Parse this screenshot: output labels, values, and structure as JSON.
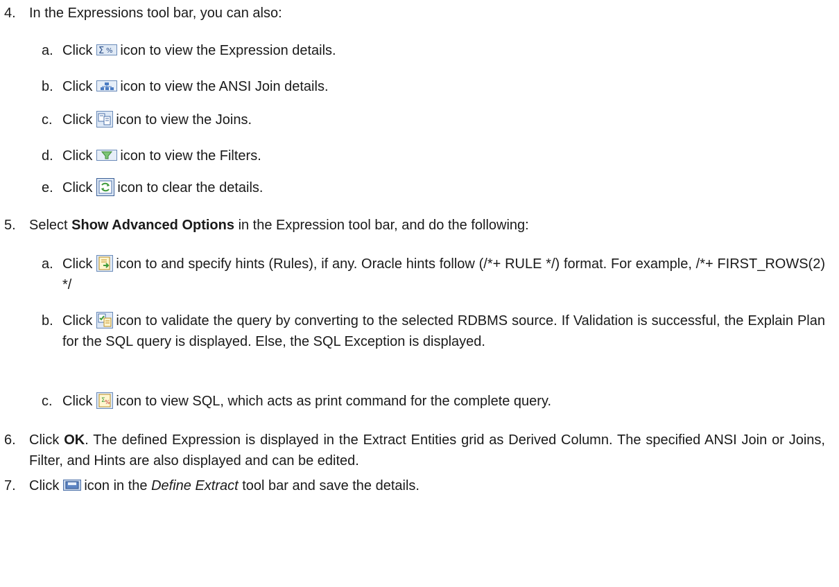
{
  "steps": {
    "s4": {
      "num": "4.",
      "text": "In the Expressions tool bar, you can also:"
    },
    "s4a": {
      "letter": "a.",
      "pre": "Click",
      "post": "icon to view the Expression details.",
      "icon": "expression-icon"
    },
    "s4b": {
      "letter": "b.",
      "pre": "Click",
      "post": "icon to view the ANSI Join details.",
      "icon": "ansi-join-icon"
    },
    "s4c": {
      "letter": "c.",
      "pre": "Click",
      "post": "icon to view the Joins.",
      "icon": "joins-icon"
    },
    "s4d": {
      "letter": "d.",
      "pre": "Click",
      "post": "icon to view the Filters.",
      "icon": "filter-icon"
    },
    "s4e": {
      "letter": "e.",
      "pre": "Click",
      "post": "icon to clear the details.",
      "icon": "clear-icon"
    },
    "s5": {
      "num": "5.",
      "pre": "Select",
      "bold": "Show Advanced Options",
      "post": "in the Expression tool bar, and do the following:"
    },
    "s5a": {
      "letter": "a.",
      "pre": "Click",
      "post": "icon to and specify hints (Rules), if any. Oracle hints follow (/*+ RULE */) format. For example, /*+ FIRST_ROWS(2) */",
      "icon": "hints-icon"
    },
    "s5b": {
      "letter": "b.",
      "pre": "Click",
      "post": "icon to validate the query by converting to the selected RDBMS source. If Validation is successful, the Explain Plan for the SQL query is displayed. Else, the SQL Exception is displayed.",
      "icon": "validate-icon"
    },
    "s5c": {
      "letter": "c.",
      "pre": "Click",
      "post": "icon to view SQL, which acts as print command for the complete query.",
      "icon": "view-sql-icon"
    },
    "s6": {
      "num": "6.",
      "pre": "Click",
      "bold": "OK",
      "post": ". The defined Expression is displayed in the Extract Entities grid as Derived Column. The specified ANSI Join or Joins, Filter, and Hints are also displayed and can be edited."
    },
    "s7": {
      "num": "7.",
      "pre": "Click",
      "post1": "icon in the",
      "italic": "Define Extract",
      "post2": "tool bar and save the details.",
      "icon": "save-icon"
    }
  }
}
